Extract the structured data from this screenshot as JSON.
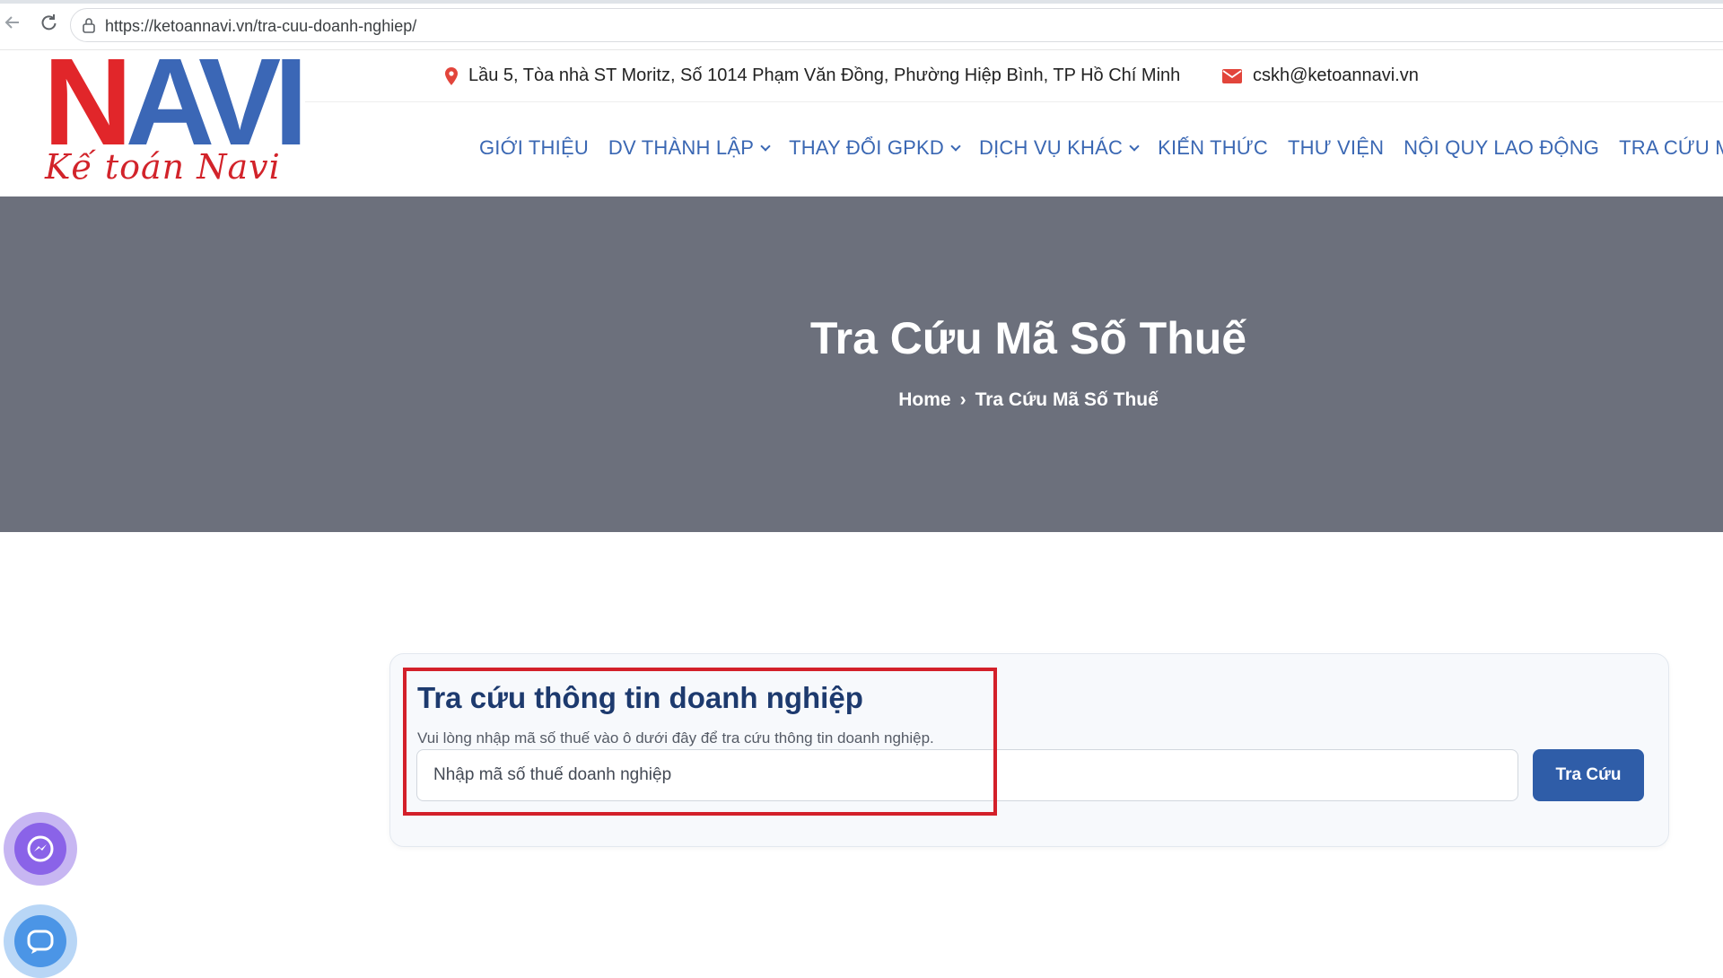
{
  "browser": {
    "url": "https://ketoannavi.vn/tra-cuu-doanh-nghiep/"
  },
  "logo": {
    "main_n": "N",
    "main_avi": "AVI",
    "tagline": "Kế toán Navi"
  },
  "topbar": {
    "address": "Lầu 5, Tòa nhà ST Moritz, Số 1014 Phạm Văn Đồng, Phường Hiệp Bình, TP Hồ Chí Minh",
    "email": "cskh@ketoannavi.vn"
  },
  "nav": {
    "items": [
      {
        "label": "GIỚI THIỆU"
      },
      {
        "label": "DV THÀNH LẬP"
      },
      {
        "label": "THAY ĐỔI GPKD"
      },
      {
        "label": "DỊCH VỤ KHÁC"
      },
      {
        "label": "KIẾN THỨC"
      },
      {
        "label": "THƯ VIỆN"
      },
      {
        "label": "NỘI QUY LAO ĐỘNG"
      },
      {
        "label": "TRA CỨU MST"
      }
    ]
  },
  "hero": {
    "title": "Tra Cứu Mã Số Thuế",
    "breadcrumb_home": "Home",
    "breadcrumb_separator": "›",
    "breadcrumb_current": "Tra Cứu Mã Số Thuế"
  },
  "search": {
    "title": "Tra cứu thông tin doanh nghiệp",
    "description": "Vui lòng nhập mã số thuế vào ô dưới đây để tra cứu thông tin doanh nghiệp.",
    "placeholder": "Nhập mã số thuế doanh nghiệp",
    "button_label": "Tra Cứu"
  },
  "colors": {
    "nav_blue": "#3a67b3",
    "hero_bg": "#6c707c",
    "button_blue": "#2f5da8",
    "highlight_red": "#d3202a"
  },
  "icons": {
    "address": "map-pin-icon",
    "email": "mail-icon",
    "messenger": "messenger-icon",
    "zalo": "zalo-icon"
  }
}
